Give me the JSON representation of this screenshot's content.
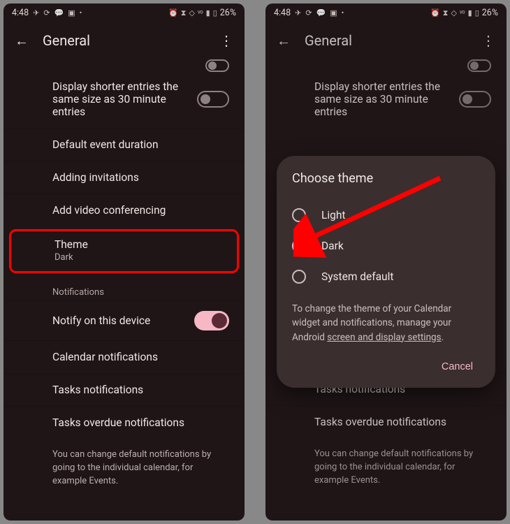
{
  "statusbar": {
    "time": "4:48",
    "battery": "26%"
  },
  "header": {
    "title": "General"
  },
  "rows": {
    "shorter_entries": "Display shorter entries the same size as 30 minute entries",
    "default_duration": "Default event duration",
    "adding_invitations": "Adding invitations",
    "video_conf": "Add video conferencing",
    "theme_label": "Theme",
    "theme_value": "Dark",
    "notifications_section": "Notifications",
    "notify_device": "Notify on this device",
    "calendar_notifs": "Calendar notifications",
    "tasks_notifs": "Tasks notifications",
    "tasks_overdue": "Tasks overdue notifications",
    "footer": "You can change default notifications by going to the individual calendar, for example Events."
  },
  "dialog": {
    "title": "Choose theme",
    "options": {
      "light": "Light",
      "dark": "Dark",
      "system": "System default"
    },
    "note_prefix": "To change the theme of your Calendar widget and notifications, manage your Android ",
    "note_link": "screen and display settings",
    "note_suffix": ".",
    "cancel": "Cancel"
  }
}
